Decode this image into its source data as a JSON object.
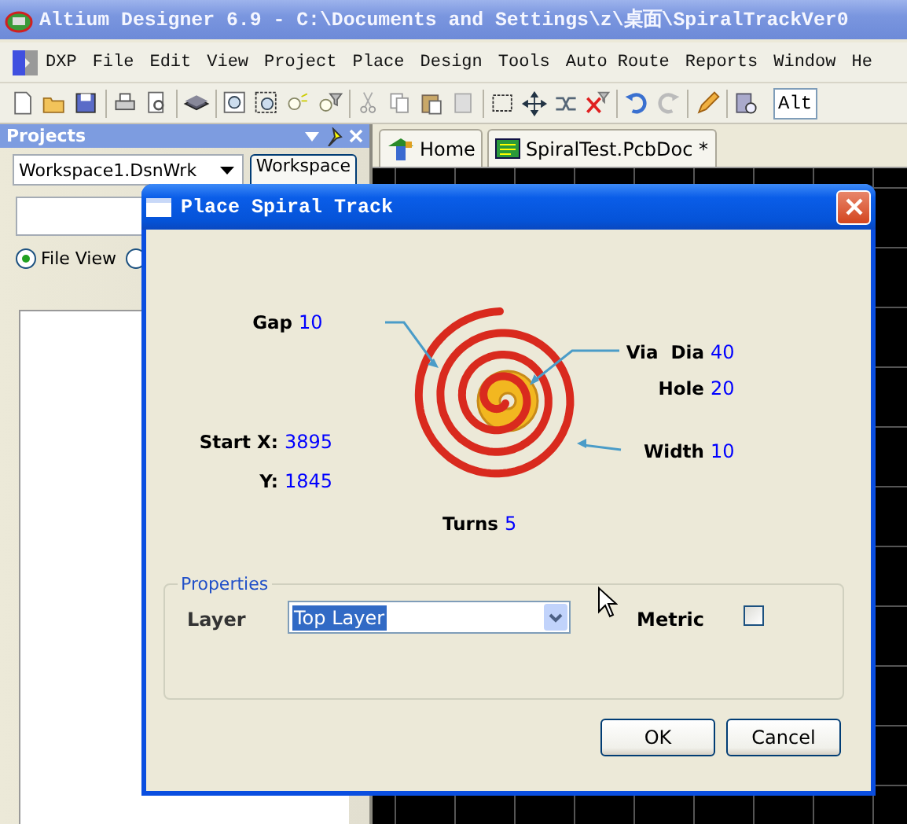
{
  "app": {
    "title": "Altium Designer 6.9 - C:\\Documents and Settings\\z\\桌面\\SpiralTrackVer0"
  },
  "menu": [
    "DXP",
    "File",
    "Edit",
    "View",
    "Project",
    "Place",
    "Design",
    "Tools",
    "Auto Route",
    "Reports",
    "Window",
    "He"
  ],
  "toolbar": {
    "combo_value": "Alt"
  },
  "projects_panel": {
    "title": "Projects",
    "workspace_combo": "Workspace1.DsnWrk",
    "workspace_button": "Workspace",
    "views": [
      {
        "label": "File View",
        "selected": true
      },
      {
        "selected": false
      }
    ]
  },
  "doc_tabs": [
    {
      "label": "Home",
      "kind": "home"
    },
    {
      "label": "SpiralTest.PcbDoc *",
      "kind": "pcb"
    }
  ],
  "dialog": {
    "title": "Place Spiral Track",
    "spiral": {
      "gap": {
        "label": "Gap",
        "value": "10"
      },
      "via_dia": {
        "label": "Via  Dia",
        "value": "40"
      },
      "hole": {
        "label": "Hole",
        "value": "20"
      },
      "width": {
        "label": "Width",
        "value": "10"
      },
      "start_x": {
        "label": "Start X:",
        "value": "3895"
      },
      "start_y": {
        "label": "Y:",
        "value": "1845"
      },
      "turns": {
        "label": "Turns",
        "value": "5"
      }
    },
    "properties": {
      "legend": "Properties",
      "layer_label": "Layer",
      "layer_value": "Top Layer",
      "metric_label": "Metric",
      "metric_checked": false
    },
    "buttons": [
      "OK",
      "Cancel"
    ]
  }
}
